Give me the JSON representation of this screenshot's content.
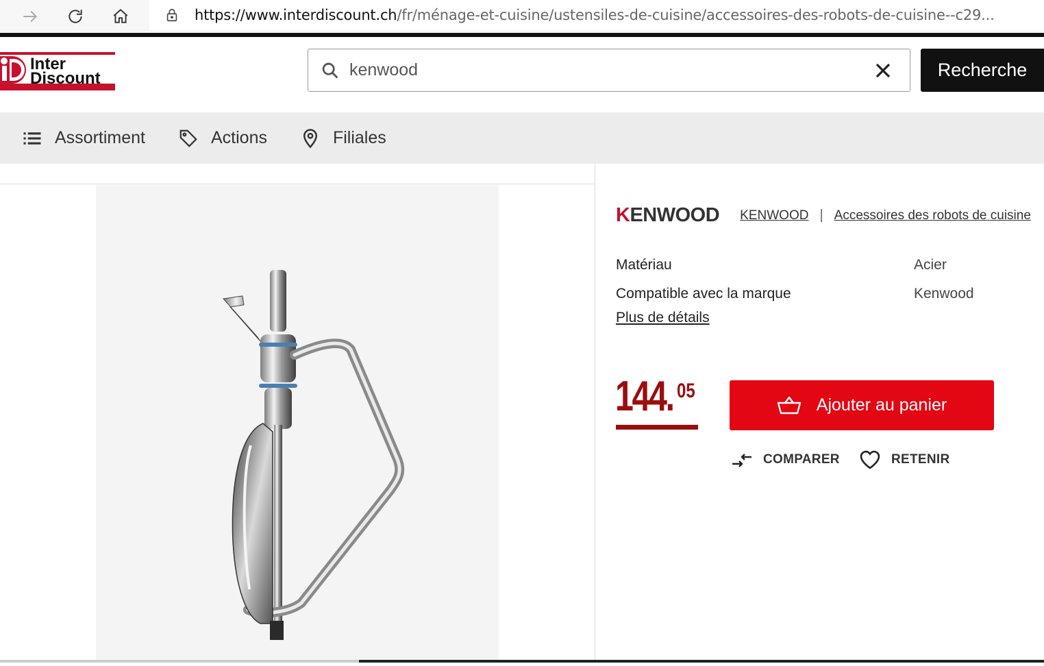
{
  "browser": {
    "url_host": "https://www.interdiscount.ch",
    "url_path": "/fr/ménage-et-cuisine/ustensiles-de-cuisine/accessoires-des-robots-de-cuisine--c29..."
  },
  "header": {
    "logo_line1": "Inter",
    "logo_line2": "Discount",
    "search_value": "kenwood",
    "search_button": "Recherche"
  },
  "nav": {
    "items": [
      {
        "label": "Assortiment",
        "icon": "list-icon"
      },
      {
        "label": "Actions",
        "icon": "tag-icon"
      },
      {
        "label": "Filiales",
        "icon": "location-pin-icon"
      }
    ]
  },
  "product": {
    "brand_logo": "KENWOOD",
    "brand_link": "KENWOOD",
    "breadcrumb_separator": "|",
    "category_link": "Accessoires des robots de cuisine",
    "specs": [
      {
        "label": "Matériau",
        "value": "Acier"
      },
      {
        "label": "Compatible avec la marque",
        "value": "Kenwood"
      }
    ],
    "more_details": "Plus de détails",
    "price_main": "144.",
    "price_cents": "05",
    "add_to_cart": "Ajouter au panier",
    "compare": "COMPARER",
    "remember": "RETENIR"
  },
  "colors": {
    "accent_red": "#e30613",
    "price_red": "#9b0e0e",
    "nav_bg": "#ececec"
  }
}
